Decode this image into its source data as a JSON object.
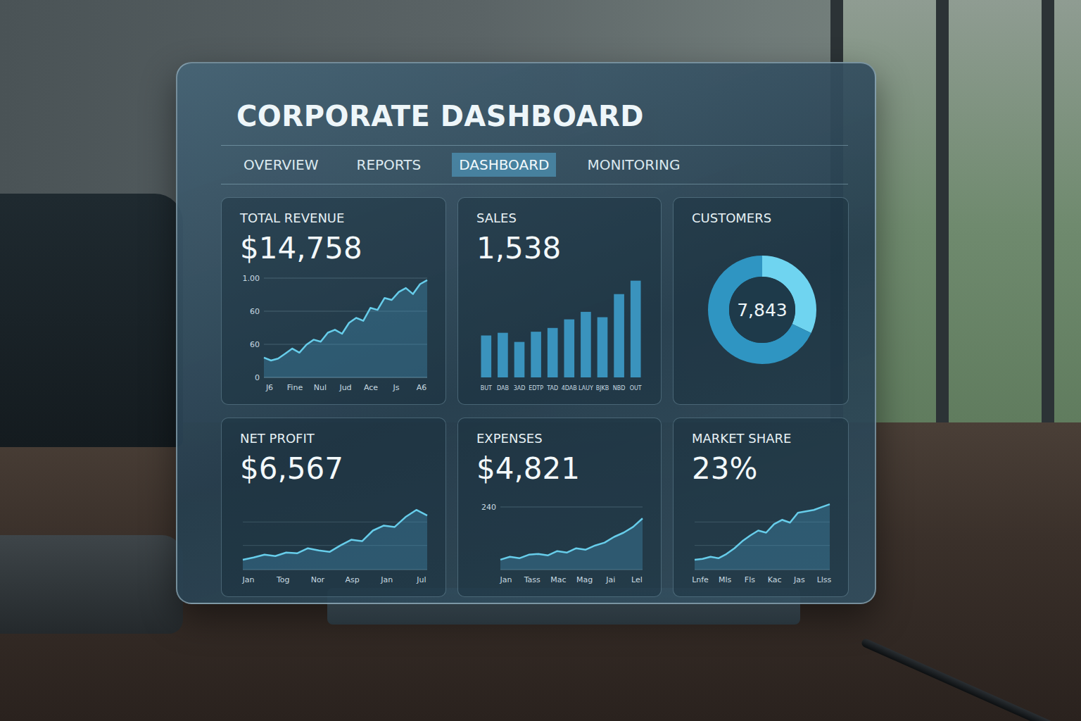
{
  "title": "CORPORATE DASHBOARD",
  "tabs": [
    {
      "label": "OVERVIEW",
      "selected": false
    },
    {
      "label": "REPORTS",
      "selected": false
    },
    {
      "label": "DASHBOARD",
      "selected": true
    },
    {
      "label": "MONITORING",
      "selected": false
    }
  ],
  "cards": [
    {
      "kind": "line",
      "title": "TOTAL REVENUE",
      "value": "$14,758",
      "ticks": [
        "1.00",
        "60",
        "60",
        "0"
      ],
      "max": 100,
      "x_labels": [
        "J6",
        "Fine",
        "Nul",
        "Jud",
        "Ace",
        "Js",
        "A6"
      ],
      "values": [
        20,
        17,
        19,
        24,
        29,
        25,
        33,
        38,
        36,
        45,
        48,
        44,
        55,
        60,
        57,
        70,
        68,
        80,
        78,
        86,
        90,
        84,
        94,
        98
      ]
    },
    {
      "kind": "bar",
      "title": "SALES",
      "value": "1,538",
      "ticks": [],
      "max": 190,
      "x_labels": [
        "BUT",
        "DAB",
        "3AD",
        "EDTP",
        "TAD",
        "4DAB",
        "LAUY",
        "BJKB",
        "NBD",
        "OUT"
      ],
      "values": [
        78,
        83,
        66,
        85,
        92,
        108,
        122,
        112,
        155,
        180
      ]
    },
    {
      "kind": "donut",
      "title": "CUSTOMERS",
      "value": "7,843",
      "segments": [
        {
          "value": 32,
          "color": "#6fd4f0"
        },
        {
          "value": 68,
          "color": "#2f95c2"
        }
      ]
    },
    {
      "kind": "line",
      "title": "NET PROFIT",
      "value": "$6,567",
      "ticks": [],
      "max": 100,
      "x_labels": [
        "Jan",
        "Tog",
        "Nor",
        "Asp",
        "Jan",
        "Jul"
      ],
      "values": [
        14,
        17,
        21,
        19,
        24,
        23,
        30,
        27,
        25,
        34,
        42,
        40,
        55,
        62,
        60,
        74,
        84,
        76
      ]
    },
    {
      "kind": "line",
      "title": "EXPENSES",
      "value": "$4,821",
      "ticks": [
        "240"
      ],
      "max": 100,
      "x_labels": [
        "Jan",
        "Tass",
        "Mac",
        "Mag",
        "Jai",
        "Lel"
      ],
      "values": [
        14,
        18,
        16,
        21,
        22,
        20,
        26,
        24,
        30,
        28,
        34,
        38,
        46,
        52,
        60,
        72
      ]
    },
    {
      "kind": "line",
      "title": "MARKET SHARE",
      "value": "23%",
      "ticks": [],
      "max": 100,
      "x_labels": [
        "Lnfe",
        "Mls",
        "Fls",
        "Kac",
        "Jas",
        "Llss"
      ],
      "values": [
        14,
        15,
        18,
        16,
        22,
        30,
        40,
        48,
        55,
        52,
        64,
        70,
        66,
        80,
        82,
        84,
        88,
        92
      ]
    }
  ]
}
